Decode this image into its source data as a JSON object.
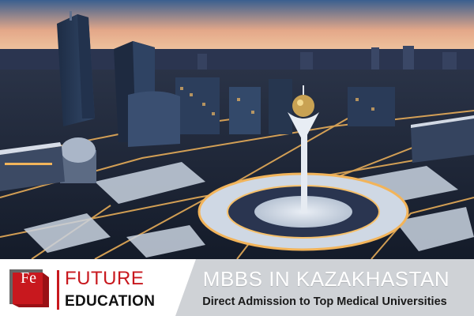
{
  "brand": {
    "mark": "Fe",
    "line1": "FUTURE",
    "line2": "EDUCATION"
  },
  "banner": {
    "headline": "MBBS IN KAZAKHASTAN",
    "subline": "Direct Admission to Top Medical Universities"
  },
  "colors": {
    "brand_red": "#c8181e",
    "panel_grey": "#cfd2d6"
  }
}
